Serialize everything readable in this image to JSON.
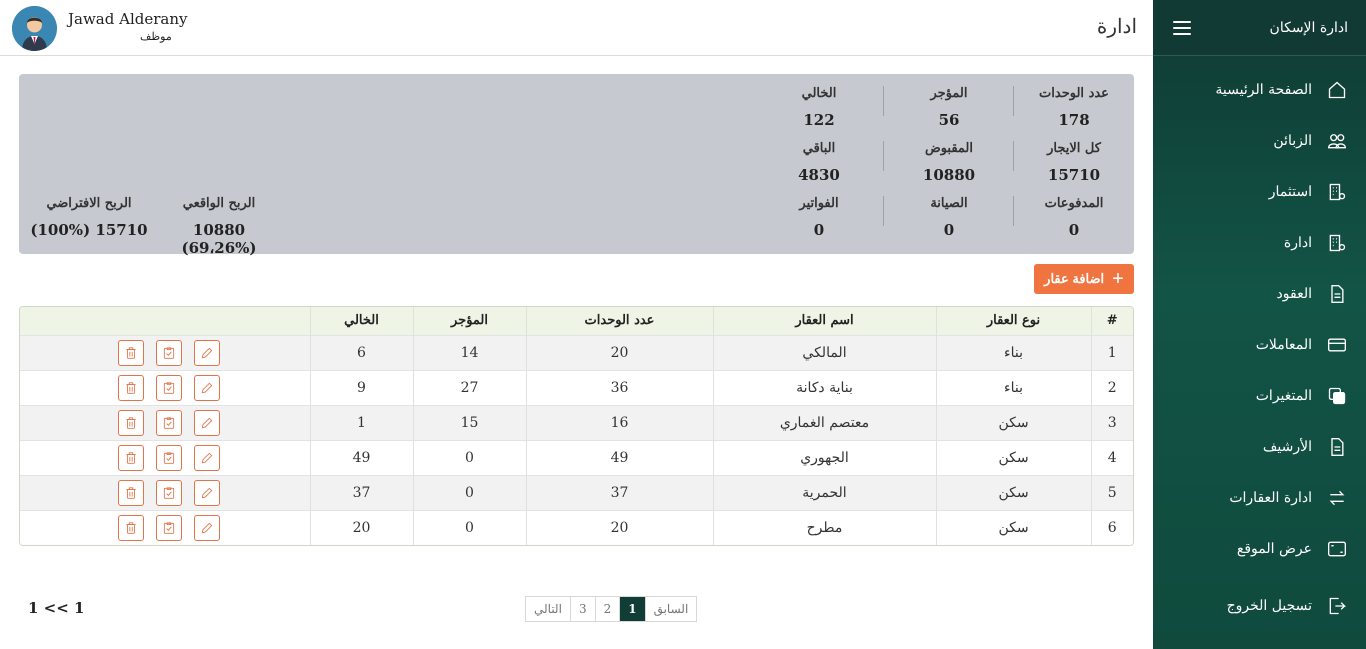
{
  "sidebar": {
    "title": "ادارة الإسكان",
    "items": [
      {
        "label": "الصفحة الرئيسية",
        "icon": "home-icon"
      },
      {
        "label": "الزبائن",
        "icon": "users-icon"
      },
      {
        "label": "استثمار",
        "icon": "building-gear-icon"
      },
      {
        "label": "ادارة",
        "icon": "building-gear-icon"
      },
      {
        "label": "العقود",
        "icon": "document-icon"
      },
      {
        "label": "المعاملات",
        "icon": "card-icon"
      },
      {
        "label": "المتغيرات",
        "icon": "copy-icon"
      },
      {
        "label": "الأرشيف",
        "icon": "document-icon"
      },
      {
        "label": "ادارة العقارات",
        "icon": "swap-arrows-icon"
      },
      {
        "label": "عرض الموقع",
        "icon": "screen-icon"
      }
    ],
    "logout": "تسجيل الخروج"
  },
  "header": {
    "user_name": "Jawad Alderany",
    "user_role": "موظف",
    "page_title": "ادارة"
  },
  "stats": {
    "units_label": "عدد الوحدات",
    "units": "178",
    "rented_label": "المؤجر",
    "rented": "56",
    "vacant_label": "الخالي",
    "vacant": "122",
    "total_rent_label": "كل الايجار",
    "total_rent": "15710",
    "received_label": "المقبوض",
    "received": "10880",
    "remaining_label": "الباقي",
    "remaining": "4830",
    "payments_label": "المدفوعات",
    "payments": "0",
    "maintenance_label": "الصيانة",
    "maintenance": "0",
    "invoices_label": "الفواتير",
    "invoices": "0",
    "real_profit_label": "الربح الواقعي",
    "real_profit": "10880 (69،26%)",
    "virtual_profit_label": "الربح الافتراضي",
    "virtual_profit": "15710 (100%)"
  },
  "add_button": {
    "label": "اضافة عقار"
  },
  "table": {
    "headers": [
      "#",
      "نوع العقار",
      "اسم العقار",
      "عدد الوحدات",
      "المؤجر",
      "الخالي",
      ""
    ],
    "rows": [
      [
        "1",
        "بناء",
        "المالكي",
        "20",
        "14",
        "6"
      ],
      [
        "2",
        "بناء",
        "بناية دكانة",
        "36",
        "27",
        "9"
      ],
      [
        "3",
        "سكن",
        "معتصم الغماري",
        "16",
        "15",
        "1"
      ],
      [
        "4",
        "سكن",
        "الجهوري",
        "49",
        "0",
        "49"
      ],
      [
        "5",
        "سكن",
        "الحمرية",
        "37",
        "0",
        "37"
      ],
      [
        "6",
        "سكن",
        "مطرح",
        "20",
        "0",
        "20"
      ]
    ]
  },
  "pagination": {
    "prev": "السابق",
    "pages": [
      "1",
      "2",
      "3"
    ],
    "active": "1",
    "next": "التالي",
    "count": "1 << 1"
  },
  "colors": {
    "accent": "#f07440",
    "sidebar": "#125446",
    "table_head": "#eef5e6"
  }
}
